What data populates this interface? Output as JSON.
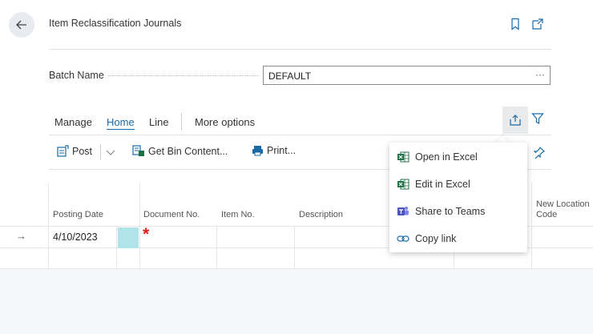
{
  "header": {
    "title": "Item Reclassification Journals"
  },
  "batch": {
    "label": "Batch Name",
    "value": "DEFAULT",
    "more": "···"
  },
  "tabs": [
    {
      "label": "Manage"
    },
    {
      "label": "Home"
    },
    {
      "label": "Line"
    },
    {
      "label": "More options"
    }
  ],
  "actions": {
    "post": "Post",
    "get_bin_content": "Get Bin Content...",
    "print": "Print..."
  },
  "columns": [
    "Posting Date",
    "Document No.",
    "Item No.",
    "Description",
    "New Location Code"
  ],
  "rows": [
    {
      "posting_date": "4/10/2023",
      "document_no_required": "*"
    }
  ],
  "share_menu": [
    {
      "label": "Open in Excel",
      "icon": "excel-icon"
    },
    {
      "label": "Edit in Excel",
      "icon": "excel-icon"
    },
    {
      "label": "Share to Teams",
      "icon": "teams-icon"
    },
    {
      "label": "Copy link",
      "icon": "link-icon"
    }
  ],
  "colors": {
    "accent": "#1a6aa6",
    "required": "#e01b1b",
    "excel": "#1e7145",
    "teams": "#4b53bc",
    "highlight": "#b0e4ea"
  }
}
